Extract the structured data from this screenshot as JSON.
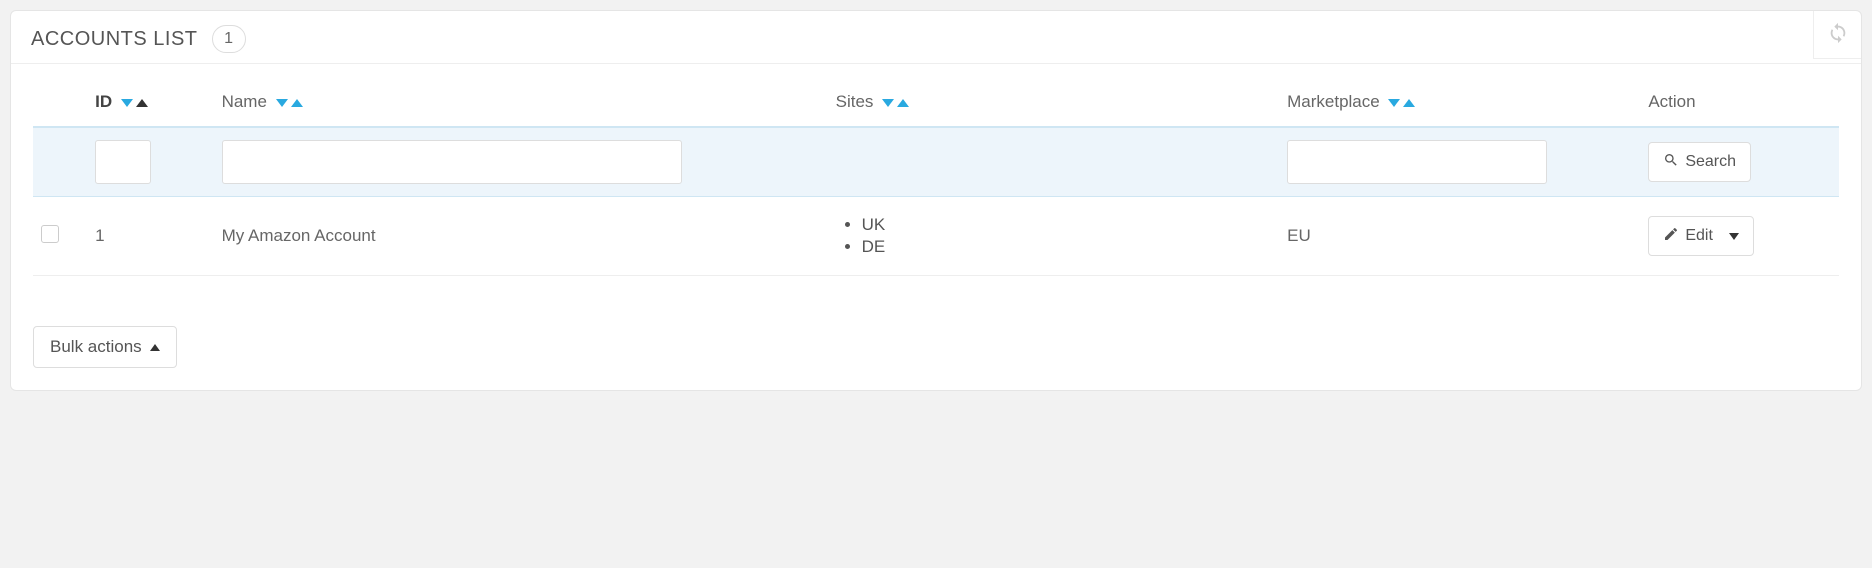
{
  "header": {
    "title": "Accounts List",
    "count": "1"
  },
  "columns": {
    "id": "ID",
    "name": "Name",
    "sites": "Sites",
    "marketplace": "Marketplace",
    "action": "Action"
  },
  "actions": {
    "search": "Search",
    "edit": "Edit",
    "bulk": "Bulk actions"
  },
  "rows": [
    {
      "id": "1",
      "name": "My Amazon Account",
      "site1": "UK",
      "site2": "DE",
      "marketplace": "EU"
    }
  ]
}
